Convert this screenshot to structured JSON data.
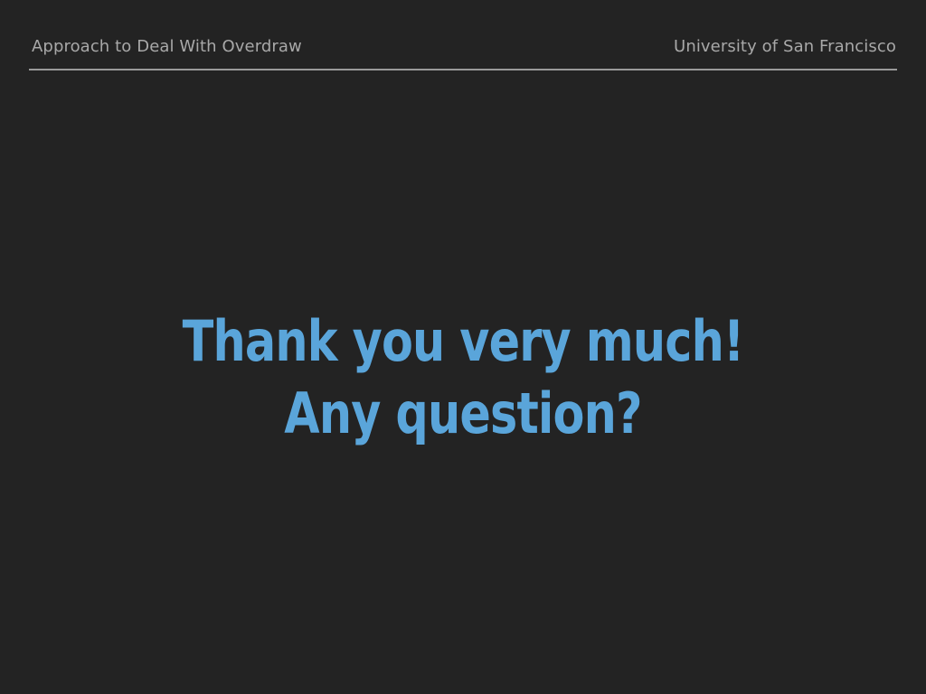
{
  "header": {
    "left_text": "Approach to Deal With Overdraw",
    "right_text": "University of San Francisco"
  },
  "main": {
    "line1": "Thank you very much!",
    "line2": "Any question?"
  },
  "colors": {
    "background": "#232323",
    "header_text": "#a8a8a8",
    "rule": "#9a9a9a",
    "accent": "#5aa5da"
  }
}
